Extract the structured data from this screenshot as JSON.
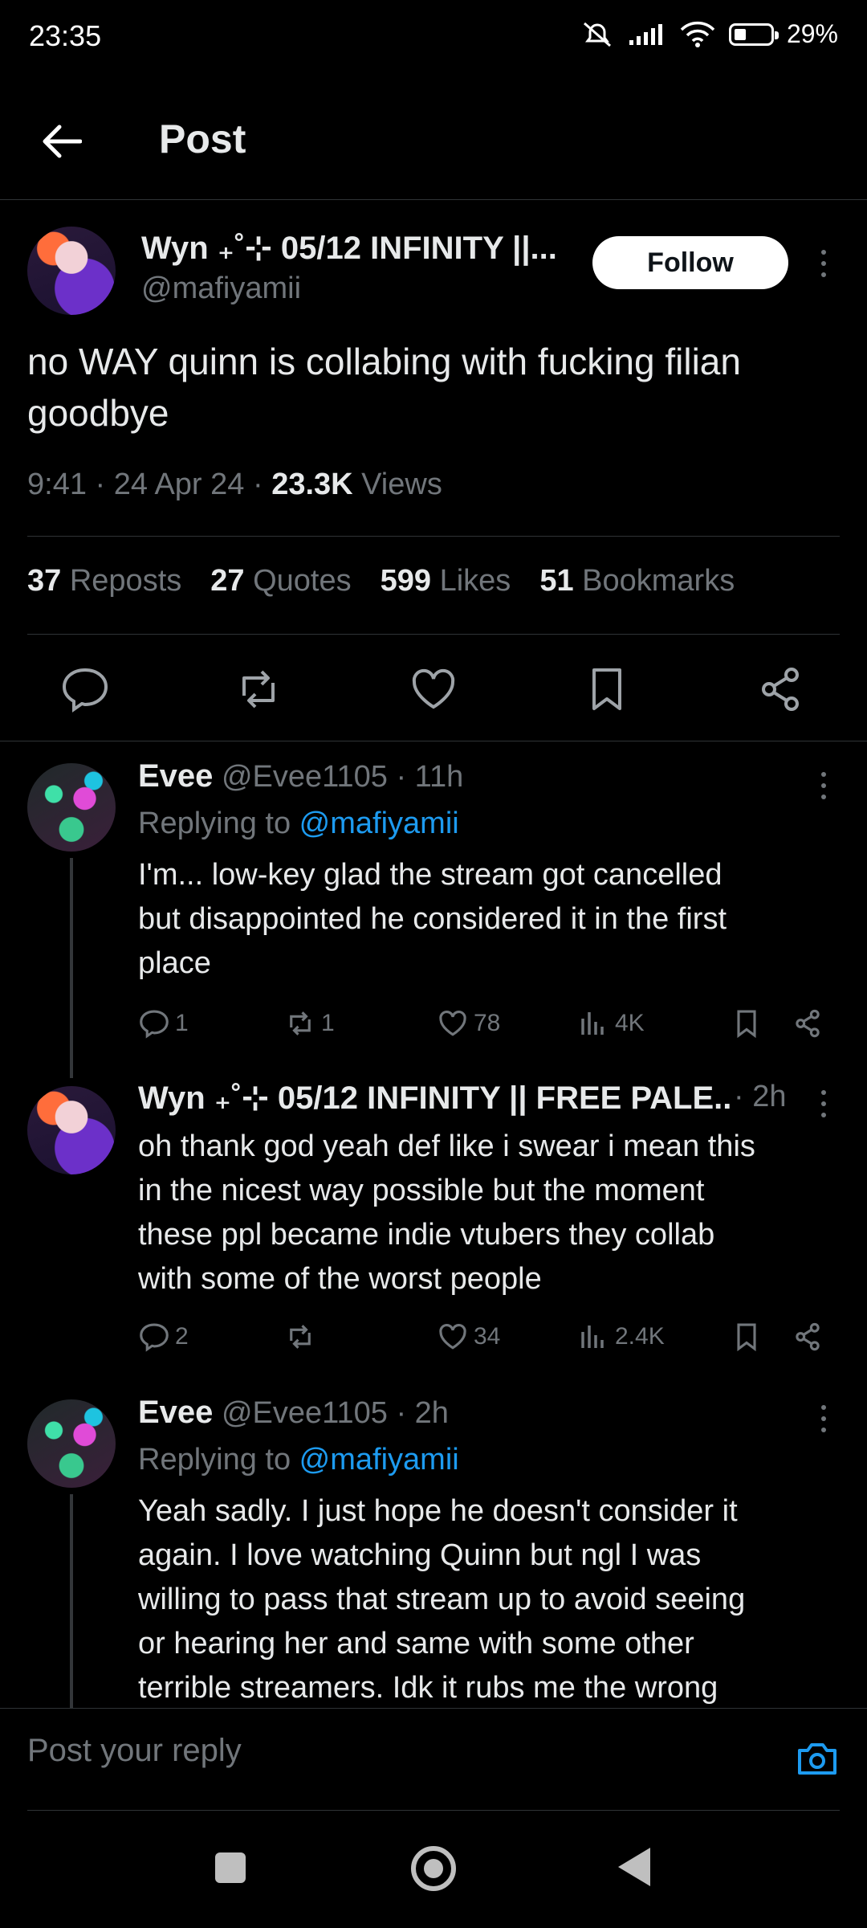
{
  "status_bar": {
    "time": "23:35",
    "battery": "29%"
  },
  "header": {
    "title": "Post"
  },
  "post": {
    "display_name": "Wyn ₊˚⊹ 05/12 INFINITY ||...",
    "handle": "@mafiyamii",
    "follow_label": "Follow",
    "text_line1": "no WAY quinn is collabing with fucking filian",
    "text_line2": "goodbye",
    "time": "9:41 · 24 Apr 24 · ",
    "views_count": "23.3K",
    "views_label": " Views",
    "stats": {
      "reposts_count": "37",
      "reposts_label": "Reposts",
      "quotes_count": "27",
      "quotes_label": "Quotes",
      "likes_count": "599",
      "likes_label": "Likes",
      "bookmarks_count": "51",
      "bookmarks_label": "Bookmarks"
    }
  },
  "replies": [
    {
      "name": "Evee",
      "handle": "@Evee1105 · 11h",
      "replying_prefix": "Replying to ",
      "replying_handle": "@mafiyamii",
      "lines": [
        "I'm... low-key glad the stream got cancelled",
        "but disappointed he considered it in the first",
        "place"
      ],
      "replies": "1",
      "reposts": "1",
      "likes": "78",
      "views": "4K"
    },
    {
      "name": "Wyn ₊˚⊹ 05/12 INFINITY || FREE PALE...",
      "handle": " · 2h",
      "lines": [
        "oh thank god yeah def like i swear i mean this",
        "in the nicest way possible but the moment",
        "these ppl became indie vtubers they collab",
        "with some of the worst people"
      ],
      "replies": "2",
      "reposts": "",
      "likes": "34",
      "views": "2.4K"
    },
    {
      "name": "Evee",
      "handle": "@Evee1105 · 2h",
      "replying_prefix": "Replying to ",
      "replying_handle": "@mafiyamii",
      "lines": [
        "Yeah sadly. I just hope he doesn't consider it",
        "again. I love watching Quinn but ngl I was",
        "willing to pass that stream up to avoid seeing",
        "or hearing her and same with some other",
        "terrible streamers. Idk it rubs me the wrong"
      ]
    }
  ],
  "reply_bar": {
    "placeholder": "Post your reply"
  },
  "colors": {
    "accent": "#1d9bf0",
    "background": "#000000",
    "muted": "#71767b"
  }
}
